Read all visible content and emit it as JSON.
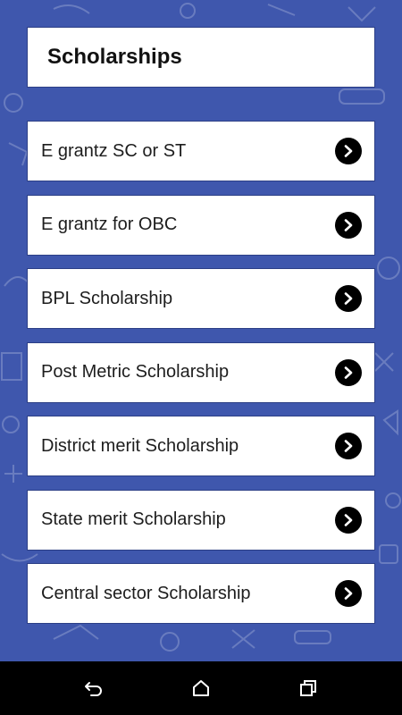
{
  "header": {
    "title": "Scholarships"
  },
  "items": [
    {
      "label": "E grantz SC or ST",
      "icon": "chevron-right-icon"
    },
    {
      "label": "E grantz for OBC",
      "icon": "chevron-right-icon"
    },
    {
      "label": "BPL Scholarship",
      "icon": "chevron-right-icon"
    },
    {
      "label": "Post Metric Scholarship",
      "icon": "chevron-right-icon"
    },
    {
      "label": "District merit Scholarship",
      "icon": "chevron-right-icon"
    },
    {
      "label": "State merit Scholarship",
      "icon": "chevron-right-icon"
    },
    {
      "label": "Central sector Scholarship",
      "icon": "chevron-right-icon"
    }
  ],
  "navbar": {
    "back_icon": "back-icon",
    "home_icon": "home-icon",
    "recents_icon": "recents-icon"
  },
  "colors": {
    "background": "#3f57ad",
    "card": "#ffffff",
    "navbar": "#000000",
    "chevron_bg": "#000000"
  }
}
